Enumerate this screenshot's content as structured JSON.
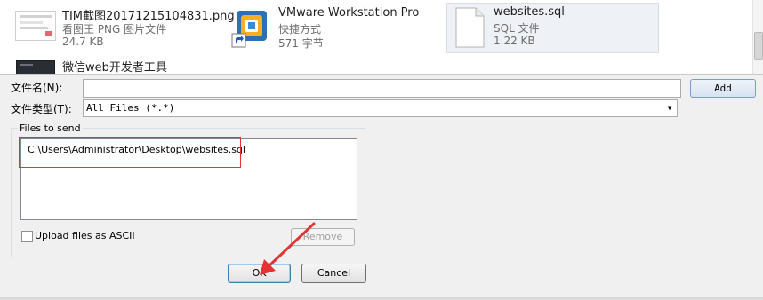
{
  "files": [
    {
      "name": "TIM截图20171215104831.png",
      "type": "看图王 PNG 图片文件",
      "size": "24.7 KB",
      "icon": "png-thumbnail-icon"
    },
    {
      "name": "VMware Workstation Pro",
      "type": "快捷方式",
      "size": "571 字节",
      "icon": "vmware-shortcut-icon"
    },
    {
      "name": "websites.sql",
      "type": "SQL 文件",
      "size": "1.22 KB",
      "icon": "sql-file-icon"
    },
    {
      "name": "微信web开发者工具",
      "icon": "wechat-devtools-icon"
    }
  ],
  "form": {
    "filename_label": "文件名(N):",
    "filename_value": "",
    "filetype_label": "文件类型(T):",
    "filetype_value": "All Files (*.*)",
    "add_button": "Add"
  },
  "send_group": {
    "title": "Files to send",
    "files": [
      "C:\\Users\\Administrator\\Desktop\\websites.sql"
    ],
    "ascii_label": "Upload files as ASCII",
    "ascii_checked": false,
    "remove_button": "Remove"
  },
  "dialog": {
    "ok_button": "OK",
    "cancel_button": "Cancel"
  },
  "colors": {
    "annotation": "#e53333",
    "selection": "#eef1f5"
  }
}
